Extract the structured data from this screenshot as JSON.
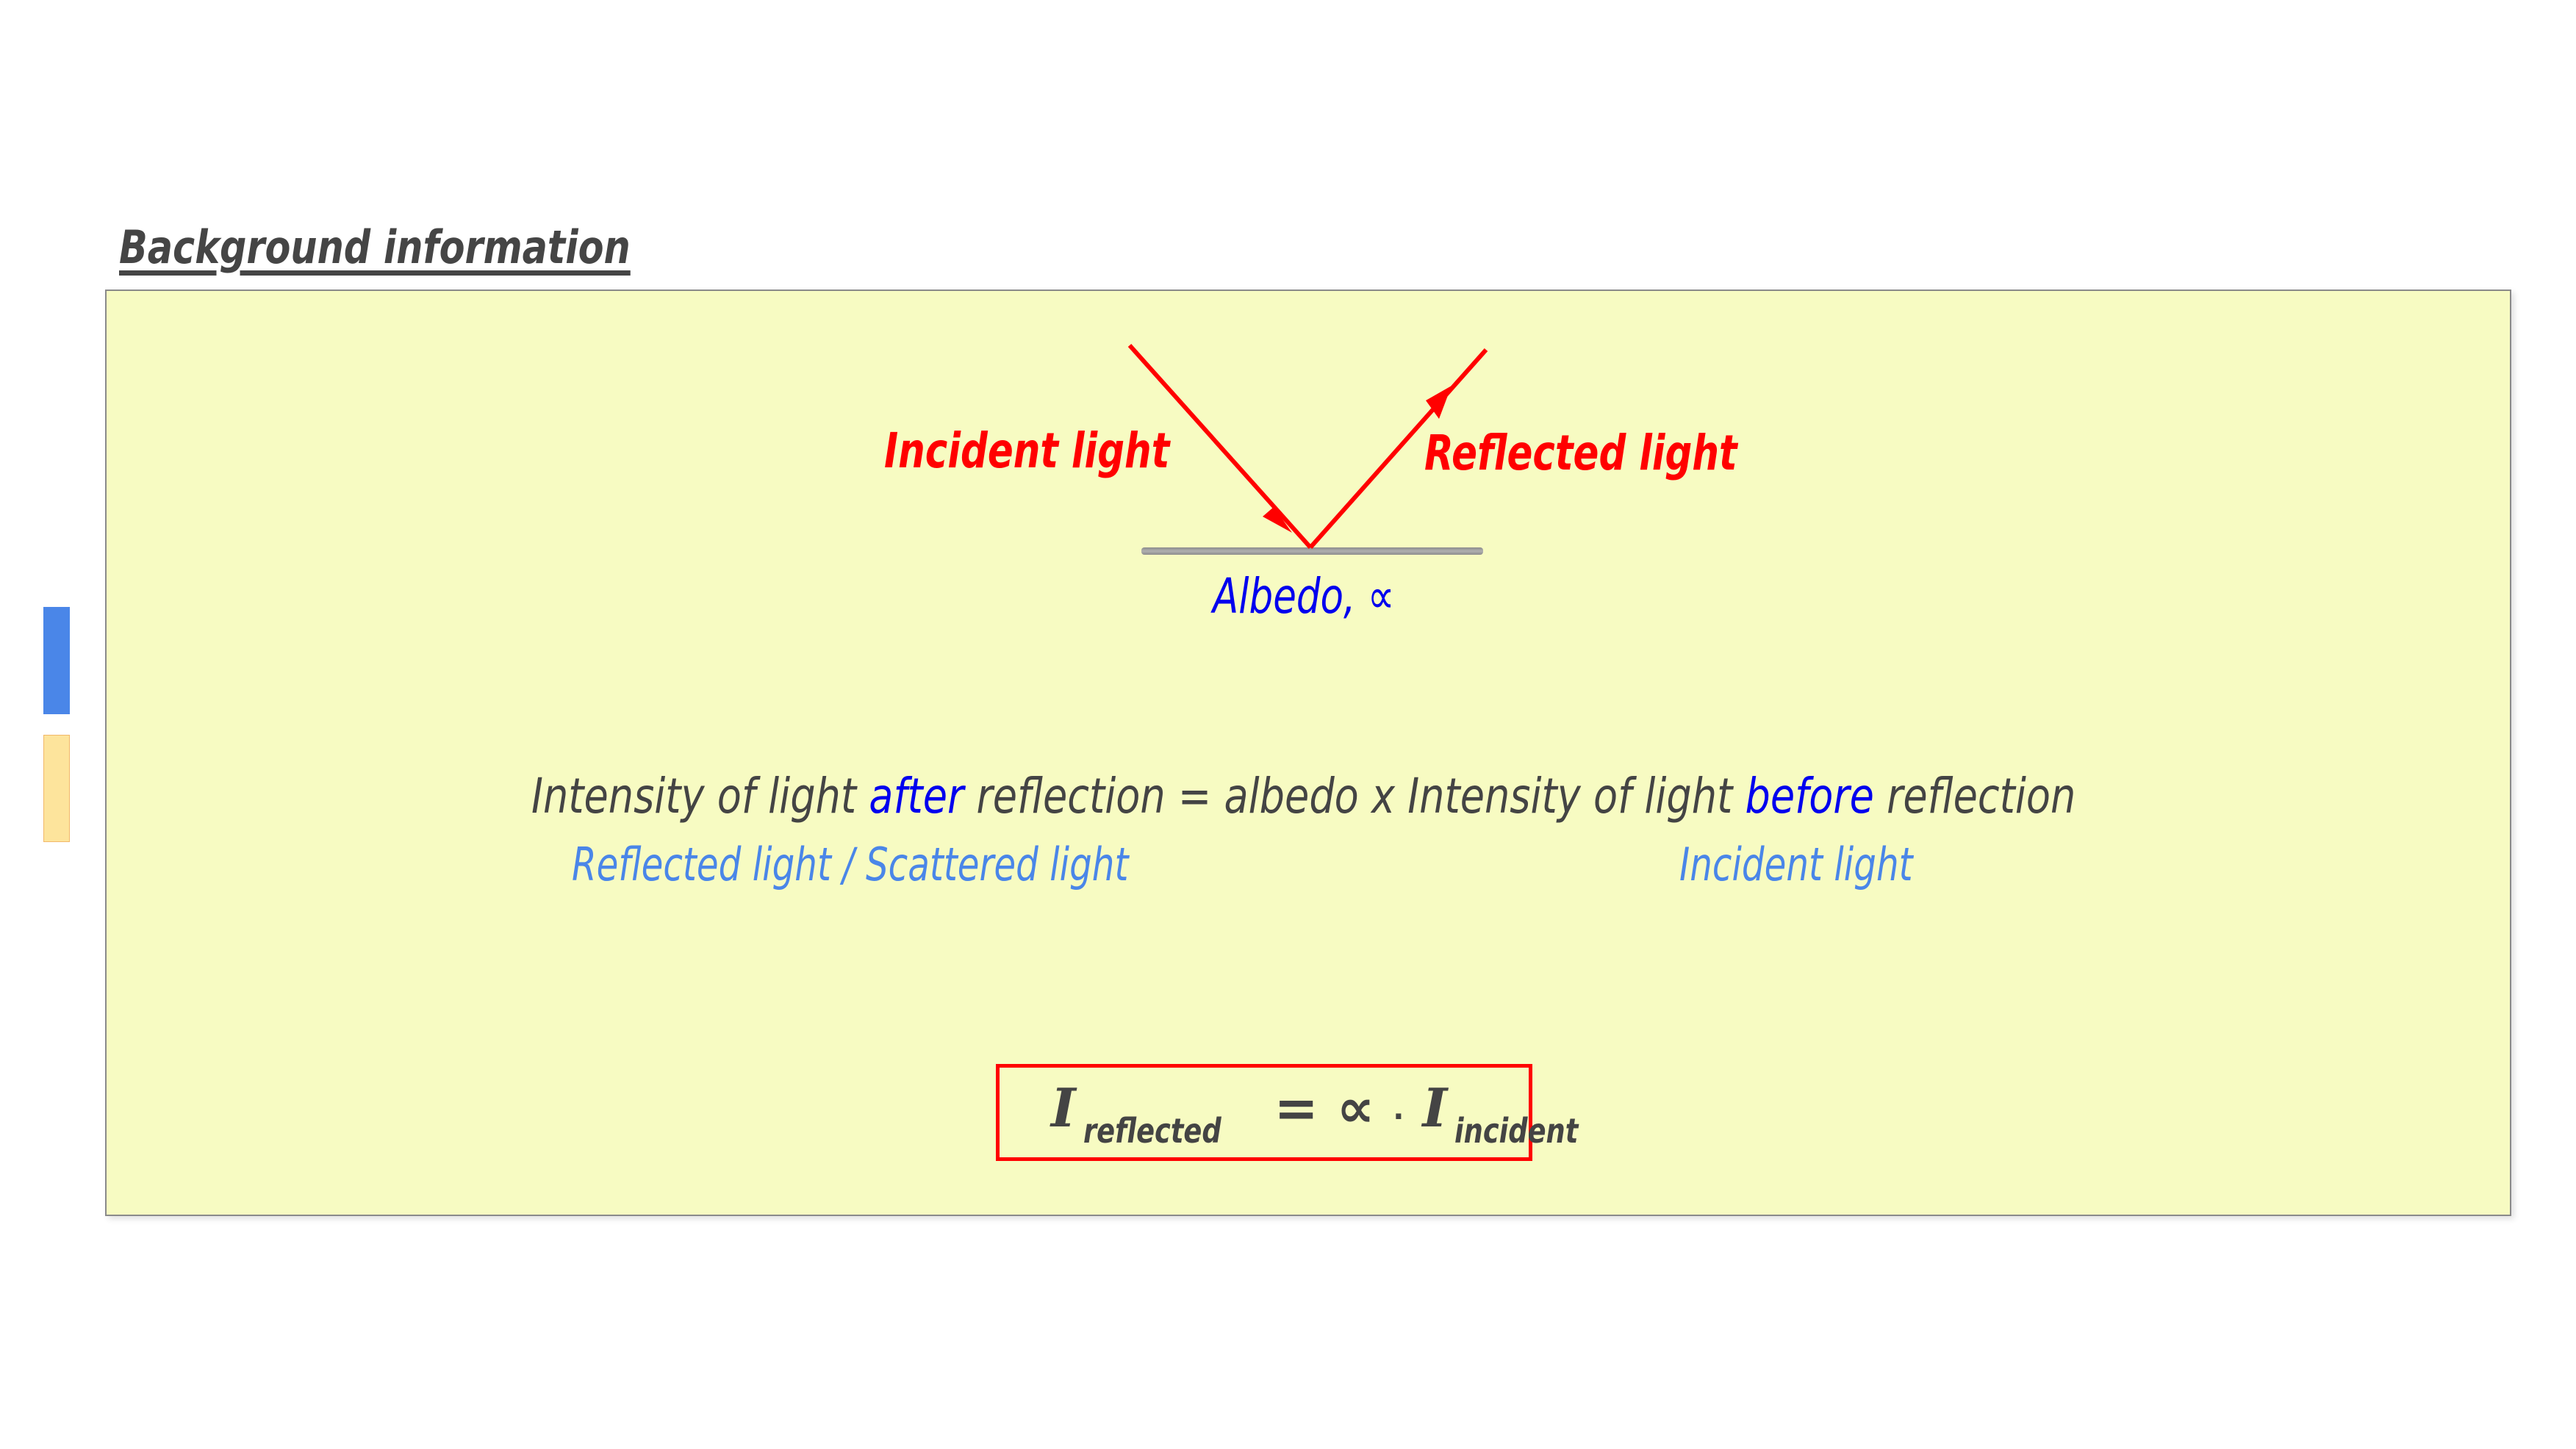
{
  "heading": "Background information",
  "side_tabs": [
    {
      "name": "blue-tab",
      "color": "#4a86e8"
    },
    {
      "name": "yellow-tab",
      "color": "#fde49c"
    }
  ],
  "note": {
    "background": "#f7fbc2",
    "diagram": {
      "incident_label": "Incident light",
      "reflected_label": "Reflected light",
      "surface_label": "Albedo, ∝",
      "ray_color": "#ff0000",
      "surface_color": "#aaaaaa"
    },
    "equation_words": {
      "part1": "Intensity of light ",
      "after": "after",
      "part2": " reflection = albedo x Intensity of light ",
      "before": "before",
      "part3": " reflection"
    },
    "annotation_left": "Reflected light / Scattered light",
    "annotation_right": "Incident light",
    "formula": {
      "lhs_symbol": "I",
      "lhs_subscript": "reflected",
      "equals": "=",
      "albedo_symbol": "∝",
      "dot": "·",
      "rhs_symbol": "I",
      "rhs_subscript": "incident"
    }
  }
}
